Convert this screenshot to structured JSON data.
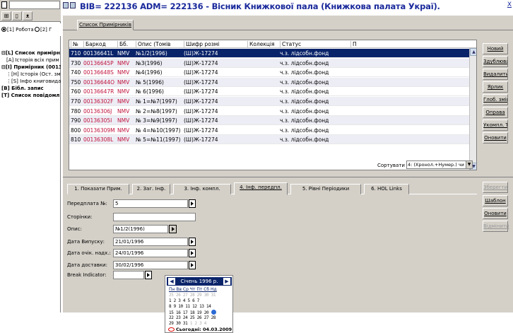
{
  "window": {
    "title": "BIB= 222136 ADM= 222136 - Вісник Книжкової пала (Книжкова палата Украї).",
    "close_label": "Х"
  },
  "left": {
    "radio_work": "[1] Робота",
    "radio_other": "[2] Г",
    "tree": [
      {
        "label": "[L] Список примірн",
        "level": 0,
        "bold": true,
        "prefix": "⊟"
      },
      {
        "label": "[A] Історія всіх прим",
        "level": 1,
        "bold": false,
        "prefix": ""
      },
      {
        "label": "[I] Примірник (00136",
        "level": 0,
        "bold": true,
        "prefix": "⊟"
      },
      {
        "label": "[H] Історія (Ост. зм",
        "level": 1,
        "bold": false,
        "prefix": "⋮"
      },
      {
        "label": "[S] Інфо книговида",
        "level": 1,
        "bold": false,
        "prefix": "⋮"
      },
      {
        "label": "[B] Бібл. запис",
        "level": 0,
        "bold": true,
        "prefix": ""
      },
      {
        "label": "[T] Список повідомл",
        "level": 0,
        "bold": true,
        "prefix": ""
      }
    ]
  },
  "upper": {
    "tab_label": "Список Примірників",
    "columns": [
      "№",
      "Баркод",
      "Бб.",
      "Опис (Томів",
      "Шифр розмі",
      "Колекція",
      "Статус",
      "П"
    ],
    "rows": [
      {
        "no": "710",
        "barcode": "00136641L",
        "sub": "NMV",
        "desc": "№1/2(1996)",
        "call": "(Ш)Ж-17274",
        "coll": "",
        "status": "ч.з. лідсобн.фонд"
      },
      {
        "no": "730",
        "barcode": "00136645P",
        "sub": "NMV",
        "desc": "№3(1996)",
        "call": "(Ш)Ж-17274",
        "coll": "",
        "status": "ч.з. лідсобн.фонд"
      },
      {
        "no": "740",
        "barcode": "00136648S",
        "sub": "NMV",
        "desc": "№4(1996)",
        "call": "(Ш)Ж-17274",
        "coll": "",
        "status": "ч.з. лідсобн.фонд"
      },
      {
        "no": "750",
        "barcode": "00136644O",
        "sub": "NMV",
        "desc": "№ 5(1996)",
        "call": "(Ш)Ж-17274",
        "coll": "",
        "status": "ч.з. лідсобн.фонд"
      },
      {
        "no": "760",
        "barcode": "00136647R",
        "sub": "NMV",
        "desc": "№ 6(1996)",
        "call": "(Ш)Ж-17274",
        "coll": "",
        "status": "ч.з. лідсобн.фонд"
      },
      {
        "no": "770",
        "barcode": "00136302F",
        "sub": "NMV",
        "desc": "№ 1=№7(1997)",
        "call": "(Ш)Ж-17274",
        "coll": "",
        "status": "ч.з. лідсобн.фонд"
      },
      {
        "no": "780",
        "barcode": "00136306J",
        "sub": "NMV",
        "desc": "№ 2=№8(1997)",
        "call": "(Ш)Ж-17274",
        "coll": "",
        "status": "ч.з. лідсобн.фонд"
      },
      {
        "no": "790",
        "barcode": "00136305I",
        "sub": "NMV",
        "desc": "№ 3=№9(1997)",
        "call": "(Ш)Ж-17274",
        "coll": "",
        "status": "ч.з. лідсобн.фонд"
      },
      {
        "no": "800",
        "barcode": "00136309M",
        "sub": "NMV",
        "desc": "№ 4=№10(1997)",
        "call": "(Ш)Ж-17274",
        "coll": "",
        "status": "ч.з. лідсобн.фонд"
      },
      {
        "no": "810",
        "barcode": "00136308L",
        "sub": "NMV",
        "desc": "№ 5=№11(1997)",
        "call": "(Ш)Ж-17274",
        "coll": "",
        "status": "ч.з. лідсобн.фонд"
      }
    ],
    "sort_label": "Сортувати за:",
    "sort_value": "4: (Хронол.+Нумер.) чи Опис (Я",
    "buttons": [
      "Новий",
      "Здублювати",
      "Видалити",
      "Ярлик",
      "Глоб. зміни",
      "Оправа",
      "Укомпл. Том",
      "Оновити"
    ]
  },
  "lower": {
    "tabs": [
      "1. Показати Прим.",
      "2. Заг. Інф.",
      "3. Інф. компл.",
      "4. Інф. передпл.",
      "5. Рівні Періодики",
      "6. HOL Links"
    ],
    "fields": {
      "subscription_label": "Передплата №:",
      "subscription_value": "5",
      "pages_label": "Сторінки:",
      "pages_value": "",
      "desc_label": "Опис:",
      "desc_value": "№1/2(1996)",
      "issue_date_label": "Дата Випуску:",
      "issue_date_value": "21/01/1996",
      "expected_label": "Дата очік. надх.:",
      "expected_value": "24/01/1996",
      "delivery_label": "Дата доставки:",
      "delivery_value": "30/02/1996",
      "break_label": "Break Indicator:",
      "break_value": ""
    },
    "calendar": {
      "month": "Січень 1996 р.",
      "weekdays": "Пн Вв Ср Чт Пт Сб Нд",
      "weeks": [
        [
          "25",
          "26",
          "27",
          "28",
          "29",
          "30",
          "31"
        ],
        [
          "1",
          "2",
          "3",
          "4",
          "5",
          "6",
          "7"
        ],
        [
          "8",
          "9",
          "10",
          "11",
          "12",
          "13",
          "14"
        ],
        [
          "15",
          "16",
          "17",
          "18",
          "19",
          "20",
          "21"
        ],
        [
          "22",
          "23",
          "24",
          "25",
          "26",
          "27",
          "28"
        ],
        [
          "29",
          "30",
          "31",
          "1",
          "2",
          "3",
          "4"
        ]
      ],
      "today": "Сьогодні: 04.03.2009"
    },
    "buttons": [
      {
        "label": "Зберегти",
        "disabled": true
      },
      {
        "label": "Шаблон",
        "disabled": false
      },
      {
        "label": "Оновити",
        "disabled": false
      },
      {
        "label": "Відмінити",
        "disabled": true
      }
    ]
  }
}
